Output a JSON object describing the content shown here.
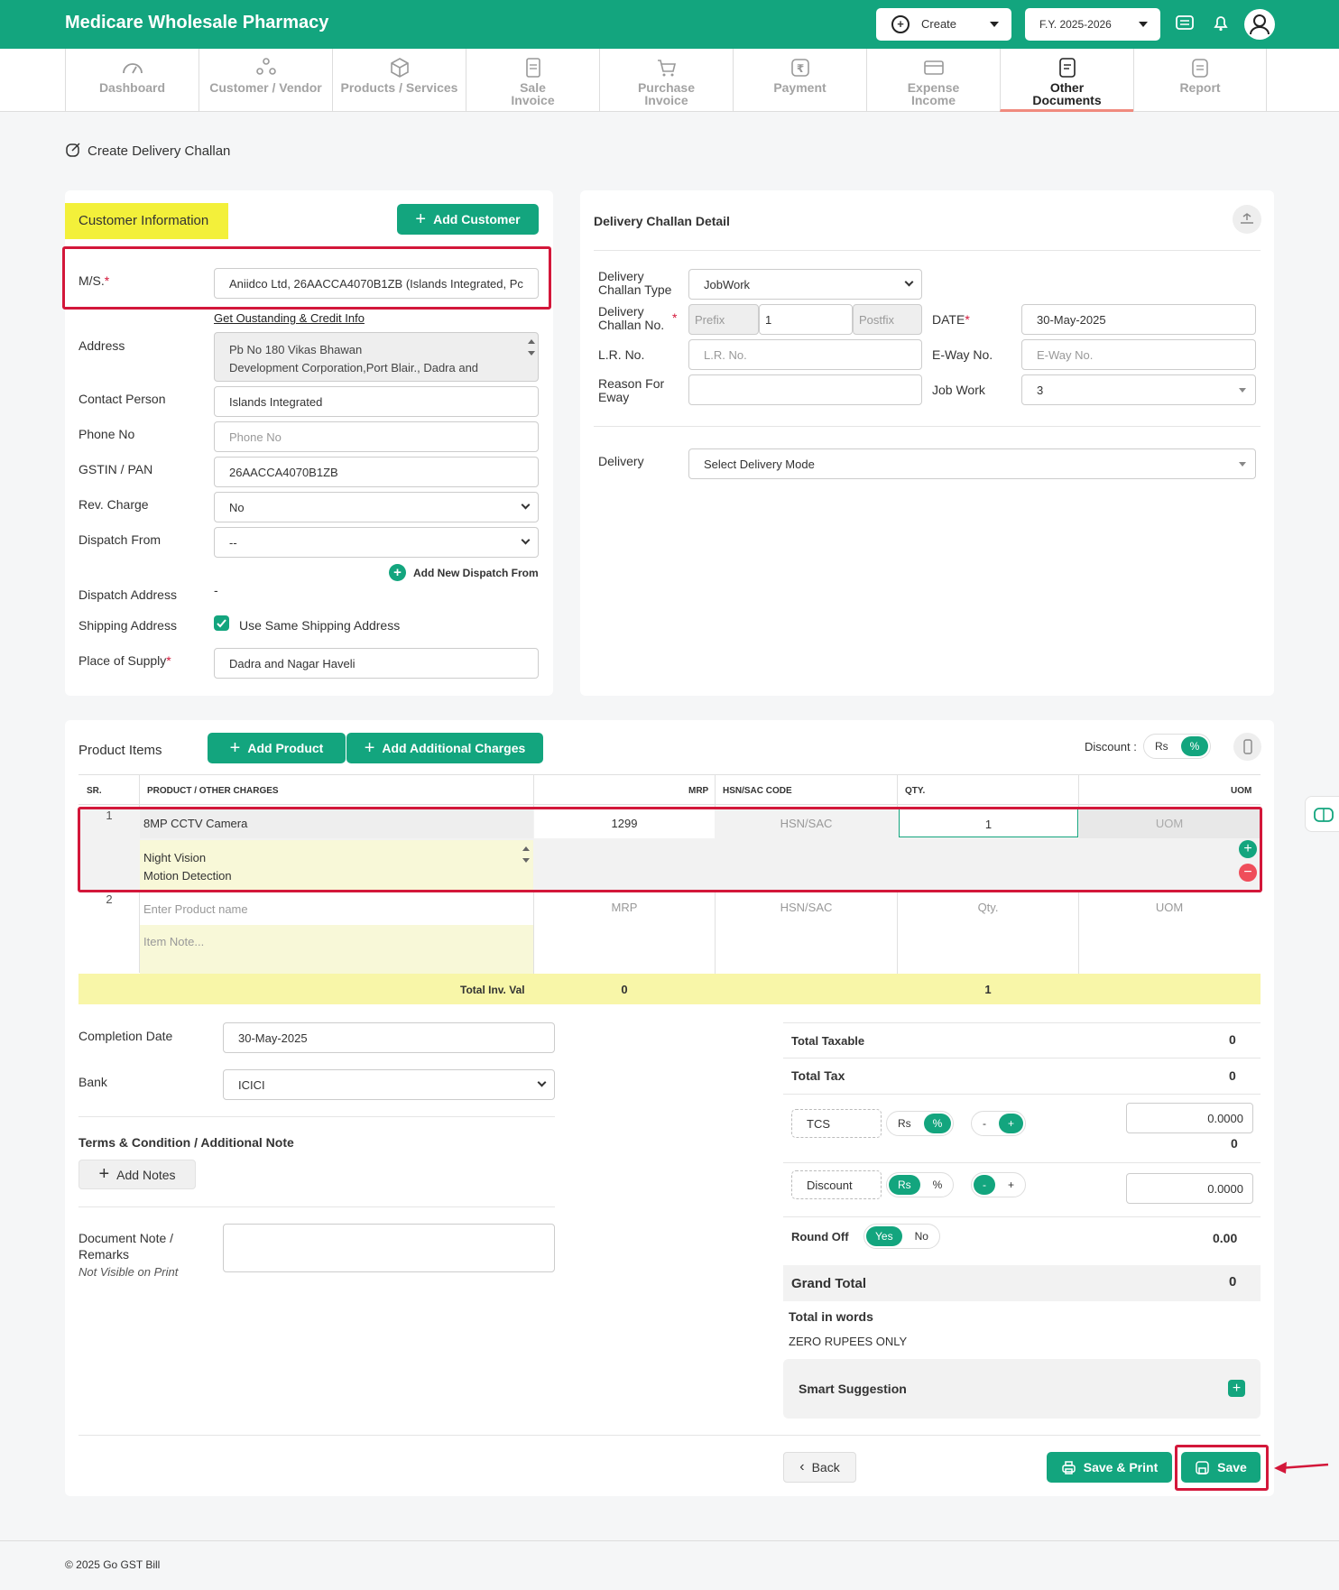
{
  "app": {
    "title": "Medicare Wholesale Pharmacy",
    "create_label": "Create",
    "fy_label": "F.Y. 2025-2026"
  },
  "nav": [
    {
      "label": "Dashboard"
    },
    {
      "label": "Customer / Vendor"
    },
    {
      "label": "Products / Services"
    },
    {
      "label": "Sale\nInvoice"
    },
    {
      "label": "Purchase\nInvoice"
    },
    {
      "label": "Payment"
    },
    {
      "label": "Expense\nIncome"
    },
    {
      "label": "Other\nDocuments"
    },
    {
      "label": "Report"
    }
  ],
  "page": {
    "title": "Create Delivery Challan"
  },
  "customer": {
    "section_title": "Customer Information",
    "add_button": "Add Customer",
    "ms_label": "M/S.",
    "ms_value": "Aniidco Ltd, 26AACCA4070B1ZB (Islands Integrated, Pc",
    "credit_link": "Get Oustanding & Credit Info",
    "address_label": "Address",
    "address_line1": "Pb No 180 Vikas Bhawan",
    "address_line2": "Development Corporation,Port Blair., Dadra and",
    "contact_label": "Contact Person",
    "contact_value": "Islands Integrated",
    "phone_label": "Phone No",
    "phone_placeholder": "Phone No",
    "gstin_label": "GSTIN / PAN",
    "gstin_value": "26AACCA4070B1ZB",
    "rev_label": "Rev. Charge",
    "rev_value": "No",
    "dispatch_label": "Dispatch From",
    "dispatch_value": "--",
    "add_dispatch": "Add New Dispatch From",
    "dispatch_addr_label": "Dispatch Address",
    "dispatch_addr_value": "-",
    "shipping_label": "Shipping Address",
    "shipping_check": "Use Same Shipping Address",
    "pos_label": "Place of Supply",
    "pos_value": "Dadra and Nagar Haveli"
  },
  "challan": {
    "section_title": "Delivery Challan Detail",
    "type_label": "Delivery\nChallan Type",
    "type_value": "JobWork",
    "no_label": "Delivery\nChallan No.",
    "prefix_placeholder": "Prefix",
    "no_value": "1",
    "postfix_placeholder": "Postfix",
    "date_label": "DATE",
    "date_value": "30-May-2025",
    "lr_label": "L.R. No.",
    "lr_placeholder": "L.R. No.",
    "eway_label": "E-Way No.",
    "eway_placeholder": "E-Way No.",
    "reason_label": "Reason For\nEway",
    "jobwork_label": "Job Work",
    "jobwork_value": "3",
    "delivery_label": "Delivery",
    "delivery_value": "Select Delivery Mode"
  },
  "items": {
    "section_title": "Product Items",
    "add_product": "Add Product",
    "add_charges": "Add Additional Charges",
    "discount_label": "Discount :",
    "disc_rs": "Rs",
    "disc_pct": "%",
    "headers": {
      "sr": "SR.",
      "product": "PRODUCT / OTHER CHARGES",
      "mrp": "MRP",
      "hsn": "HSN/SAC CODE",
      "qty": "QTY.",
      "uom": "UOM"
    },
    "row1": {
      "sr": "1",
      "name": "8MP CCTV Camera",
      "note1": "Night Vision",
      "note2": "Motion Detection",
      "mrp": "1299",
      "hsn": "HSN/SAC",
      "qty": "1",
      "uom": "UOM"
    },
    "row2": {
      "sr": "2",
      "name": "Enter Product name",
      "note": "Item Note...",
      "mrp": "MRP",
      "hsn": "HSN/SAC",
      "qty": "Qty.",
      "uom": "UOM"
    },
    "total": {
      "label": "Total Inv. Val",
      "mrp": "0",
      "qty": "1"
    }
  },
  "footer_left": {
    "completion_label": "Completion Date",
    "completion_value": "30-May-2025",
    "bank_label": "Bank",
    "bank_value": "ICICI",
    "terms_title": "Terms & Condition / Additional Note",
    "add_notes": "Add Notes",
    "doc_note_label": "Document Note /\nRemarks",
    "doc_note_sub": "Not Visible on Print"
  },
  "totals": {
    "taxable_label": "Total Taxable",
    "taxable_value": "0",
    "tax_label": "Total Tax",
    "tax_value": "0",
    "tcs_label": "TCS",
    "tcs_rs": "Rs",
    "tcs_pct": "%",
    "tcs_minus": "-",
    "tcs_plus": "+",
    "tcs_input": "0.0000",
    "tcs_value": "0",
    "disc_label": "Discount",
    "disc_rs": "Rs",
    "disc_pct": "%",
    "disc_minus": "-",
    "disc_plus": "+",
    "disc_input": "0.0000",
    "round_label": "Round Off",
    "round_yes": "Yes",
    "round_no": "No",
    "round_value": "0.00",
    "grand_label": "Grand Total",
    "grand_value": "0",
    "words_label": "Total in words",
    "words_value": "ZERO RUPEES ONLY",
    "smart_label": "Smart Suggestion"
  },
  "actions": {
    "back": "Back",
    "save_print": "Save & Print",
    "save": "Save"
  },
  "copyright": "© 2025 Go GST Bill",
  "colors": {
    "brand": "#13a57e",
    "highlight": "#f3f03a",
    "alert": "#d3173a",
    "row_yellow": "#f8f8d8"
  }
}
